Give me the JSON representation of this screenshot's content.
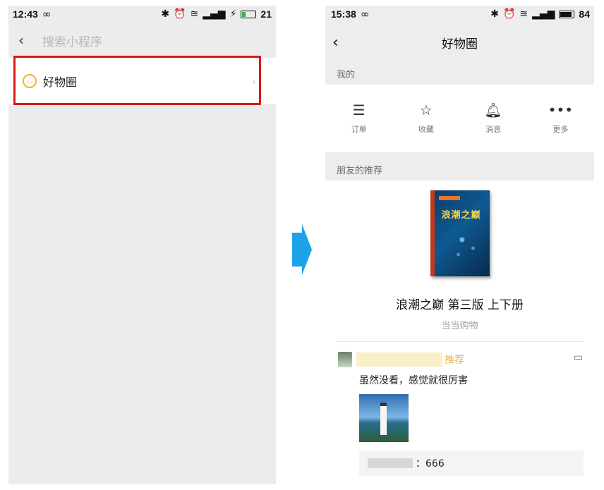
{
  "left_phone": {
    "status": {
      "time": "12:43",
      "battery": "21"
    },
    "search": {
      "placeholder": "搜索小程序"
    },
    "result": {
      "label": "好物圈"
    }
  },
  "right_phone": {
    "status": {
      "time": "15:38",
      "battery": "84"
    },
    "nav": {
      "title": "好物圈"
    },
    "my_section": "我的",
    "actions": [
      {
        "label": "订单",
        "icon": "order-icon"
      },
      {
        "label": "收藏",
        "icon": "star-icon"
      },
      {
        "label": "消息",
        "icon": "bell-icon"
      },
      {
        "label": "更多",
        "icon": "more-icon"
      }
    ],
    "friends_section": "朋友的推荐",
    "product": {
      "cover_title": "浪潮之巅",
      "title": "浪潮之巅 第三版 上下册",
      "shop": "当当购物"
    },
    "post": {
      "recommend_label": "推荐",
      "text": "虽然没看，感觉就很厉害",
      "reply": "：666"
    }
  },
  "colors": {
    "highlight": "#d71a1a",
    "arrow": "#1aa3e8",
    "accent": "#f0b23a"
  }
}
